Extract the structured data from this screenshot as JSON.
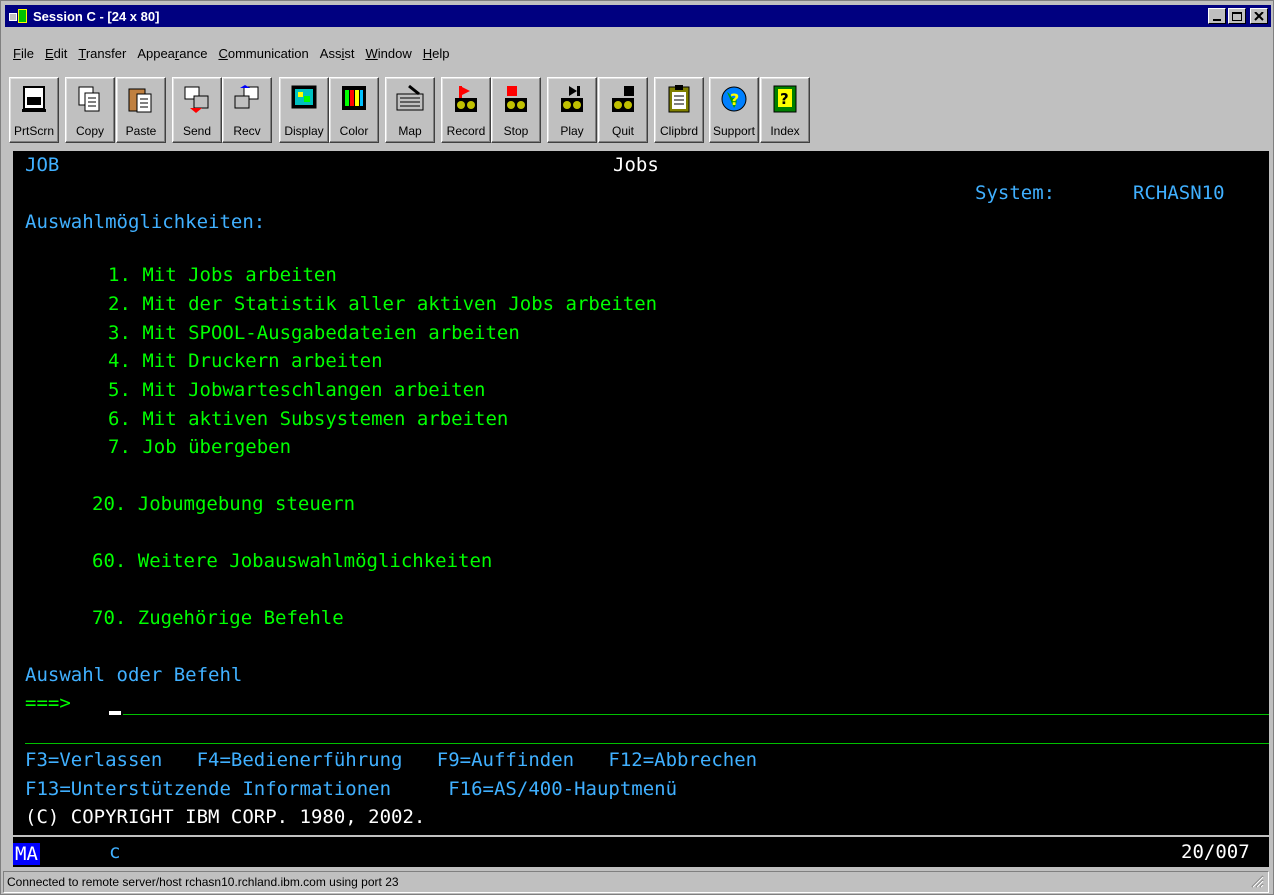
{
  "window": {
    "title": "Session C - [24 x 80]",
    "controls": [
      "minimize",
      "maximize",
      "close"
    ]
  },
  "menu": [
    {
      "pre": "",
      "u": "F",
      "post": "ile"
    },
    {
      "pre": "",
      "u": "E",
      "post": "dit"
    },
    {
      "pre": "",
      "u": "T",
      "post": "ransfer"
    },
    {
      "pre": "Appea",
      "u": "r",
      "post": "ance"
    },
    {
      "pre": "",
      "u": "C",
      "post": "ommunication"
    },
    {
      "pre": "Ass",
      "u": "i",
      "post": "st"
    },
    {
      "pre": "",
      "u": "W",
      "post": "indow"
    },
    {
      "pre": "",
      "u": "H",
      "post": "elp"
    }
  ],
  "toolbar": [
    {
      "label": "PrtScrn",
      "icon": "printer-icon"
    },
    {
      "label": "Copy",
      "icon": "copy-icon"
    },
    {
      "label": "Paste",
      "icon": "paste-icon"
    },
    {
      "label": "Send",
      "icon": "send-icon"
    },
    {
      "label": "Recv",
      "icon": "receive-icon"
    },
    {
      "label": "Display",
      "icon": "display-icon"
    },
    {
      "label": "Color",
      "icon": "color-icon"
    },
    {
      "label": "Map",
      "icon": "keyboard-map-icon"
    },
    {
      "label": "Record",
      "icon": "record-icon"
    },
    {
      "label": "Stop",
      "icon": "stop-icon"
    },
    {
      "label": "Play",
      "icon": "play-icon"
    },
    {
      "label": "Quit",
      "icon": "quit-icon"
    },
    {
      "label": "Clipbrd",
      "icon": "clipboard-icon"
    },
    {
      "label": "Support",
      "icon": "support-globe-icon"
    },
    {
      "label": "Index",
      "icon": "index-help-icon"
    }
  ],
  "screen": {
    "menu_id": "JOB",
    "title": "Jobs",
    "system_label": "System:",
    "system_name": "RCHASN10",
    "options_heading": "Auswahlmöglichkeiten:",
    "options": [
      "1. Mit Jobs arbeiten",
      "2. Mit der Statistik aller aktiven Jobs arbeiten",
      "3. Mit SPOOL-Ausgabedateien arbeiten",
      "4. Mit Druckern arbeiten",
      "5. Mit Jobwarteschlangen arbeiten",
      "6. Mit aktiven Subsystemen arbeiten",
      "7. Job übergeben"
    ],
    "option_20": "20. Jobumgebung steuern",
    "option_60": "60. Weitere Jobauswahlmöglichkeiten",
    "option_70": "70. Zugehörige Befehle",
    "prompt_label": "Auswahl oder Befehl",
    "command_arrow": "===>",
    "command_value": "",
    "function_keys_line1": "F3=Verlassen   F4=Bedienerführung   F9=Auffinden   F12=Abbrechen",
    "function_keys_line2": "F13=Unterstützende Informationen     F16=AS/400-Hauptmenü",
    "copyright": "(C) COPYRIGHT IBM CORP. 1980, 2002."
  },
  "oia": {
    "mode": "MA",
    "connection_indicator": "c",
    "cursor_position": "20/007"
  },
  "status": {
    "text": "Connected to remote server/host rchasn10.rchland.ibm.com using port 23"
  },
  "colors": {
    "terminal_bg": "#000000",
    "field_text": "#00ff00",
    "label_text": "#40b0ff",
    "title_bar": "#000080"
  }
}
